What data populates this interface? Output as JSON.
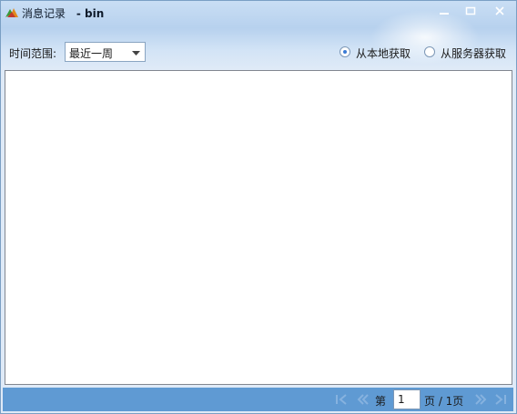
{
  "window": {
    "title": "消息记录",
    "title_separator": "-",
    "user": "bin",
    "accent": "#5f9ad3",
    "controls": {
      "minimize": "minimize-icon",
      "maximize": "maximize-icon",
      "close": "close-icon"
    }
  },
  "toolbar": {
    "range_label": "时间范围:",
    "range_value": "最近一周",
    "source_local": "从本地获取",
    "source_server": "从服务器获取",
    "selected_source": "local"
  },
  "pagination": {
    "page_prefix": "第",
    "current_page": "1",
    "page_suffix": "页 / 1页"
  }
}
